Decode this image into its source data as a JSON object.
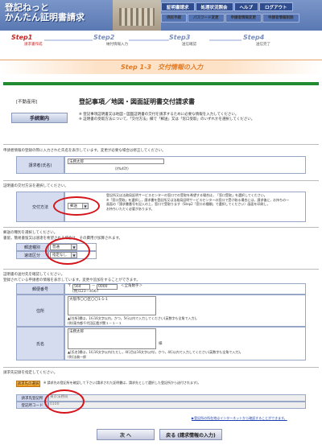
{
  "header": {
    "logo_line1": "登記ねっと",
    "logo_line2": "かんたん証明書請求",
    "nav_top": [
      "証明書請求",
      "処理状況照会",
      "ヘルプ",
      "ログアウト"
    ],
    "nav_bottom": [
      "供託手続",
      "パスワード変更",
      "申請者情報変更",
      "申請者情報削除"
    ]
  },
  "steps": [
    {
      "num": "Step1",
      "label": "請求書作成"
    },
    {
      "num": "Step2",
      "label": "納付情報入力"
    },
    {
      "num": "Step3",
      "label": "送信確認"
    },
    {
      "num": "Step4",
      "label": "送信完了"
    }
  ],
  "subtitle": "Step 1-3　交付情報の入力",
  "doc": {
    "tag": "[不動産用]",
    "title": "登記事項／地図・図面証明書交付請求書",
    "guide_button": "手続案内",
    "notes": [
      "※ 登記事項証明書又は地図・図面証明書の交付を請求するために必要な情報を入力してください。",
      "※ 証明書の受取方法について，「交付方法」欄で「郵送」又は「窓口受取」のいずれかを選択してください。"
    ]
  },
  "requester": {
    "note": "申請者情報の登録の際に入力された氏名を表示しています。変更が必要な場合は修正してください。",
    "label": "請求者(氏名)",
    "value": "法務太郎",
    "kana": "（ﾎｳﾑﾀﾛｳ）"
  },
  "delivery": {
    "note": "証明書の交付方法を選択してください。",
    "label": "交付方法",
    "value": "郵送",
    "help": [
      "登記所又は法務局証明サービスセンターの窓口での受取を希望する場合は，「窓口受取」を選択してください。",
      "※「窓口受取」を選択し，請求書を登記所又は法務局証明サービスセンターの窓口で受け取る場合には，請求後に，お持ちの一",
      "画面の「請求書番号を記入の上，窓口で受取ります（Step2「窓口の種類」で選択してください）画面を印刷し，",
      "お持ちいただく必要があります。"
    ]
  },
  "mailing": {
    "note1": "郵送の種別を選択してください。",
    "note2": "書留，簡易書留又は速達を希望される場合は，その費用が加算されます。",
    "type_label": "郵送種別",
    "type_value": "普通",
    "express_label": "速達区分",
    "express_value": "指定なし"
  },
  "address": {
    "note1": "証明書の送付先を確認してください。",
    "note2": "登録されている申請者の情報を表示しています。変更や追加をすることができます。",
    "zip_label": "郵便番号",
    "zip1": "564",
    "zip2": "0000",
    "zip_hint": "＜全角数字＞",
    "zip_example": "(例)123－4567",
    "addr_label": "住所",
    "addr_value": "大阪市〇〇区〇〇1-1-1",
    "addr_help": "▲[住所]欄は，1行16文字以内，かつ，5行以内で入力してください(英数字も全角で入力)。",
    "addr_example": "(例)東京都千代田区霞が関１－１－１",
    "name_label": "氏名",
    "name_value": "法務太郎",
    "name_suffix": "様",
    "name_help": "▲[氏名]欄は，1行16文字以内(ただし，4行目は16文字以内)，かつ，4行以内で入力してください(英数字も全角で入力)。",
    "name_example": "(例)法務一郎"
  },
  "billing": {
    "note": "請求先記録を指定してください。",
    "button": "請求先の選択",
    "help": "※ 請求先の登記所を確認して下さい(請求された証明書は，請求先として選択した登記所から送付されます)。",
    "office_label": "請求先登記所",
    "office_value": "東京法務局",
    "code_label": "登記所コード",
    "code_value": "0100"
  },
  "link_text": "▶登記所の所在地はインターネットから確認することができます。",
  "buttons": {
    "next": "次 へ",
    "back": "戻る (請求情報の入力)"
  }
}
